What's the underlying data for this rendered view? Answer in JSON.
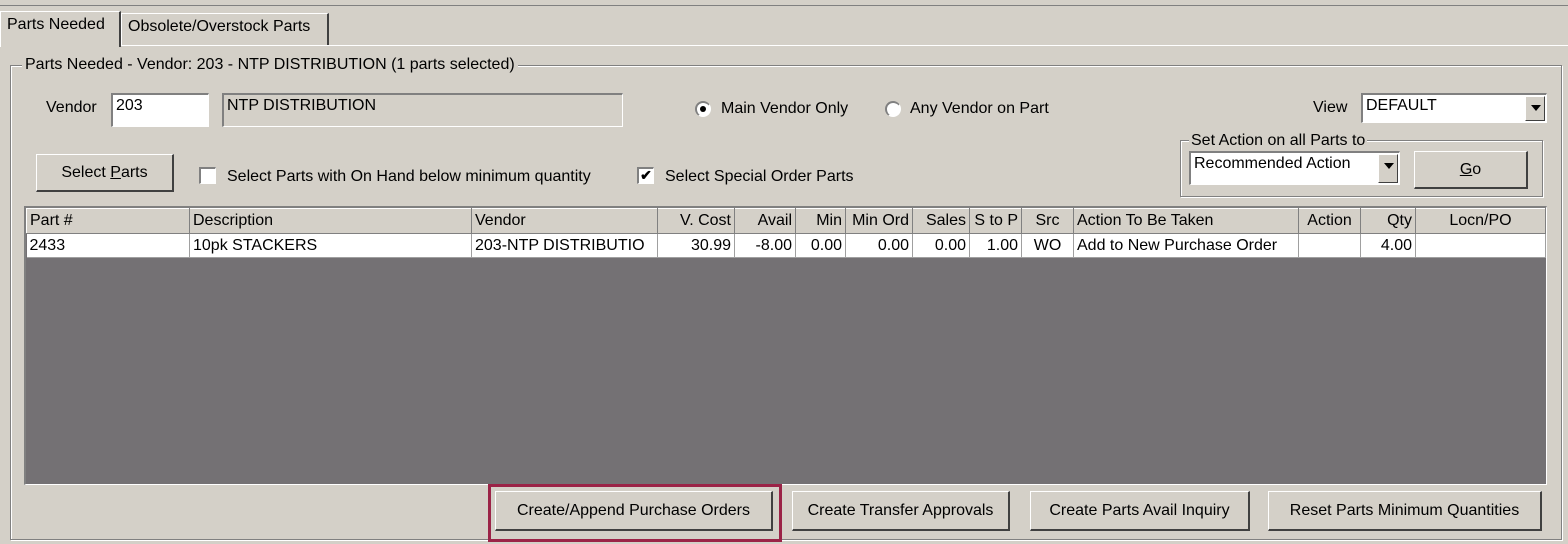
{
  "tabs": [
    {
      "label": "Parts Needed",
      "active": true
    },
    {
      "label": "Obsolete/Overstock Parts",
      "active": false
    }
  ],
  "group_title": "Parts Needed - Vendor: 203 - NTP DISTRIBUTION (1 parts selected)",
  "vendor": {
    "label": "Vendor",
    "code": "203",
    "name": "NTP DISTRIBUTION"
  },
  "vendor_scope": {
    "options": [
      {
        "label": "Main Vendor Only",
        "selected": true
      },
      {
        "label": "Any Vendor on Part",
        "selected": false
      }
    ]
  },
  "view": {
    "label": "View",
    "value": "DEFAULT"
  },
  "select_parts_button": {
    "prefix": "Select ",
    "hotkey": "P",
    "suffix": "arts"
  },
  "checkboxes": [
    {
      "label": "Select Parts with On Hand below minimum quantity",
      "checked": false
    },
    {
      "label": "Select Special Order Parts",
      "checked": true
    }
  ],
  "set_action": {
    "legend": "Set Action on all Parts to",
    "value": "Recommended Action",
    "go_hotkey": "G",
    "go_suffix": "o"
  },
  "table": {
    "columns": [
      "Part #",
      "Description",
      "Vendor",
      "V. Cost",
      "Avail",
      "Min",
      "Min Ord",
      "Sales",
      "S to P",
      "Src",
      "Action To Be Taken",
      "Action",
      "Qty",
      "Locn/PO"
    ],
    "rows": [
      [
        "2433",
        "10pk STACKERS",
        "203-NTP DISTRIBUTIO",
        "30.99",
        "-8.00",
        "0.00",
        "0.00",
        "0.00",
        "1.00",
        "WO",
        "Add to New Purchase Order",
        "",
        "4.00",
        ""
      ]
    ]
  },
  "bottom_buttons": [
    "Create/Append Purchase Orders",
    "Create Transfer Approvals",
    "Create Parts Avail Inquiry",
    "Reset Parts Minimum Quantities"
  ],
  "colors": {
    "window_bg": "#d4d0c8",
    "grid_empty_bg": "#747174",
    "highlight_border": "#9b2347"
  }
}
